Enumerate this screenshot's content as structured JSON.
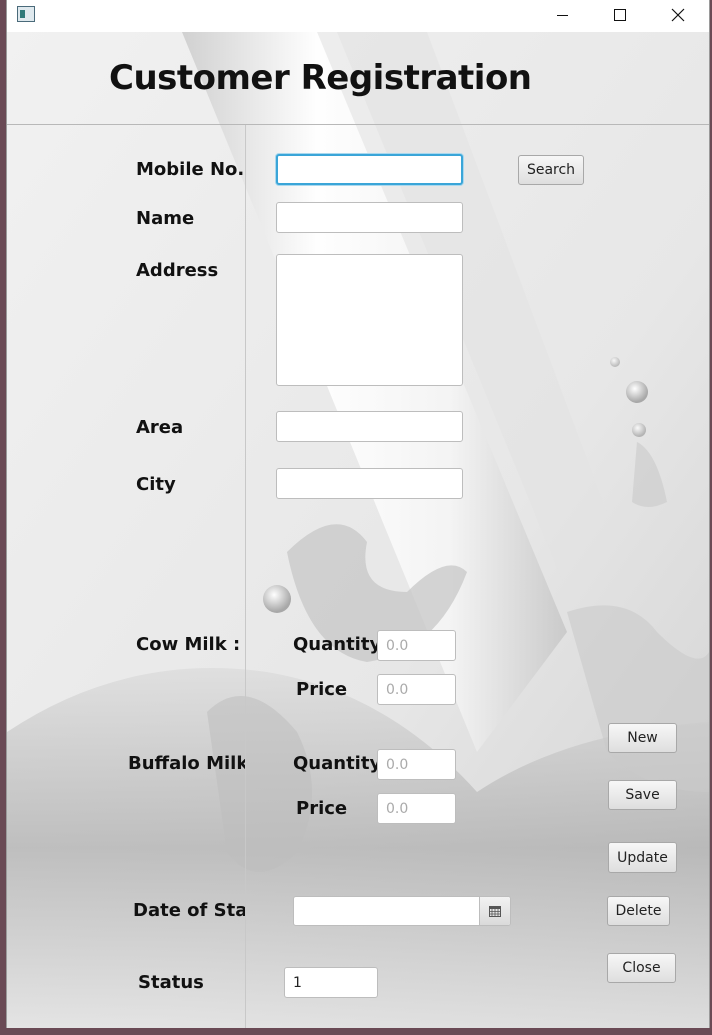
{
  "form": {
    "title": "Customer Registration",
    "labels": {
      "mobile": "Mobile No.",
      "name": "Name",
      "address": "Address",
      "area": "Area",
      "city": "City",
      "cow_milk": "Cow Milk :",
      "buffalo_milk": "Buffalo Milk :",
      "quantity": "Quantity",
      "price": "Price",
      "date_of_start": "Date of Start",
      "status": "Status"
    },
    "fields": {
      "mobile": "",
      "name": "",
      "address": "",
      "area": "",
      "city": "",
      "cow_quantity_placeholder": "0.0",
      "cow_price_placeholder": "0.0",
      "buffalo_quantity_placeholder": "0.0",
      "buffalo_price_placeholder": "0.0",
      "date_of_start": "",
      "status": "1"
    },
    "buttons": {
      "search": "Search",
      "new": "New",
      "save": "Save",
      "update": "Update",
      "delete": "Delete",
      "close": "Close"
    }
  },
  "icons": {
    "app": "app-window-icon",
    "calendar": "calendar-icon",
    "minimize": "minimize-icon",
    "maximize": "maximize-icon",
    "close": "close-icon"
  },
  "colors": {
    "focus_border": "#3aa5d8"
  }
}
